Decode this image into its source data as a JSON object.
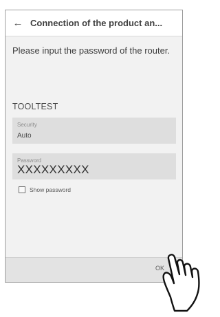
{
  "appbar": {
    "back_icon": "arrow-left-icon",
    "title": "Connection of the product an..."
  },
  "prompt": "Please input the password of the router.",
  "ssid": "TOOLTEST",
  "security": {
    "label": "Security",
    "value": "Auto"
  },
  "password": {
    "label": "Password",
    "value": "XXXXXXXXX"
  },
  "show_password": {
    "label": "Show password",
    "checked": false
  },
  "bottom_bar": {
    "ok_label": "OK"
  },
  "overlay": {
    "icon": "pointing-hand-icon"
  }
}
